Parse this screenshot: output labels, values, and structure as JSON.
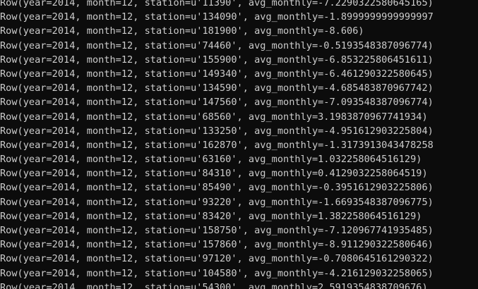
{
  "terminal": {
    "lines": [
      "Row(year=2014, month=12, station=u'11390', avg_monthly=-7.2290322580645165)",
      "Row(year=2014, month=12, station=u'134090', avg_monthly=-1.8999999999999997",
      "Row(year=2014, month=12, station=u'181900', avg_monthly=-8.606)",
      "Row(year=2014, month=12, station=u'74460', avg_monthly=-0.5193548387096774)",
      "Row(year=2014, month=12, station=u'155900', avg_monthly=-6.853225806451611)",
      "Row(year=2014, month=12, station=u'149340', avg_monthly=-6.461290322580645)",
      "Row(year=2014, month=12, station=u'134590', avg_monthly=-4.685483870967742)",
      "Row(year=2014, month=12, station=u'147560', avg_monthly=-7.093548387096774)",
      "Row(year=2014, month=12, station=u'68560', avg_monthly=3.1983870967741934)",
      "Row(year=2014, month=12, station=u'133250', avg_monthly=-4.951612903225804)",
      "Row(year=2014, month=12, station=u'162870', avg_monthly=-1.3173913043478258",
      "Row(year=2014, month=12, station=u'63160', avg_monthly=1.032258064516129)",
      "Row(year=2014, month=12, station=u'84310', avg_monthly=0.4129032258064519)",
      "Row(year=2014, month=12, station=u'85490', avg_monthly=-0.3951612903225806)",
      "Row(year=2014, month=12, station=u'93220', avg_monthly=-1.6693548387096775)",
      "Row(year=2014, month=12, station=u'83420', avg_monthly=1.382258064516129)",
      "Row(year=2014, month=12, station=u'158750', avg_monthly=-7.120967741935485)",
      "Row(year=2014, month=12, station=u'157860', avg_monthly=-8.911290322580646)",
      "Row(year=2014, month=12, station=u'97120', avg_monthly=-0.7080645161290322)",
      "Row(year=2014, month=12, station=u'104580', avg_monthly=-4.216129032258065)",
      "Row(year=2014, month=12, station=u'54300', avg_monthly=2.5919354838709676)"
    ]
  }
}
